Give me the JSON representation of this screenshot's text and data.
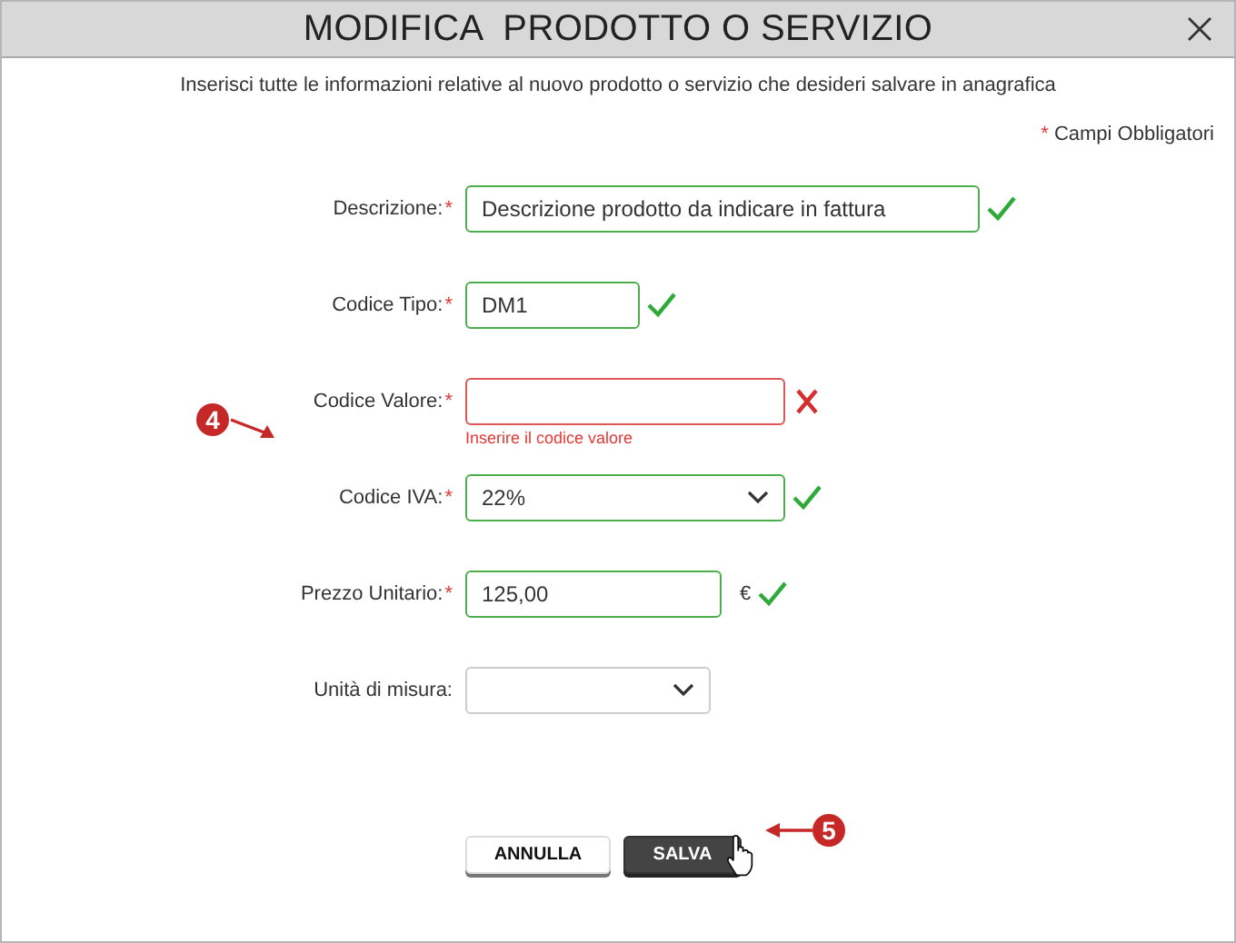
{
  "window": {
    "title": "MODIFICA  PRODOTTO O SERVIZIO"
  },
  "intro": "Inserisci tutte le informazioni relative al nuovo prodotto o servizio che desideri salvare in anagrafica",
  "required_note": {
    "mark": "*",
    "text": "Campi Obbligatori"
  },
  "fields": [
    {
      "kind": "text",
      "label": "Descrizione:",
      "required": true,
      "value": "Descrizione prodotto da indicare in fattura",
      "valid": true
    },
    {
      "kind": "text",
      "label": "Codice Tipo:",
      "required": true,
      "value": "DM1",
      "valid": true
    },
    {
      "kind": "text",
      "label": "Codice Valore:",
      "required": true,
      "valid": false,
      "error": "Inserire il codice valore"
    },
    {
      "kind": "select",
      "label": "Codice IVA:",
      "required": true,
      "value": "22%",
      "valid": true
    },
    {
      "kind": "text",
      "label": "Prezzo Unitario:",
      "required": true,
      "value": "125,00",
      "suffix": "€",
      "valid": true
    },
    {
      "kind": "select",
      "label": "Unità di misura:",
      "required": false
    }
  ],
  "buttons": [
    {
      "label": "ANNULLA",
      "kind": "secondary"
    },
    {
      "label": "SALVA",
      "kind": "primary"
    }
  ],
  "callouts": [
    {
      "label": "4"
    },
    {
      "label": "5"
    }
  ]
}
